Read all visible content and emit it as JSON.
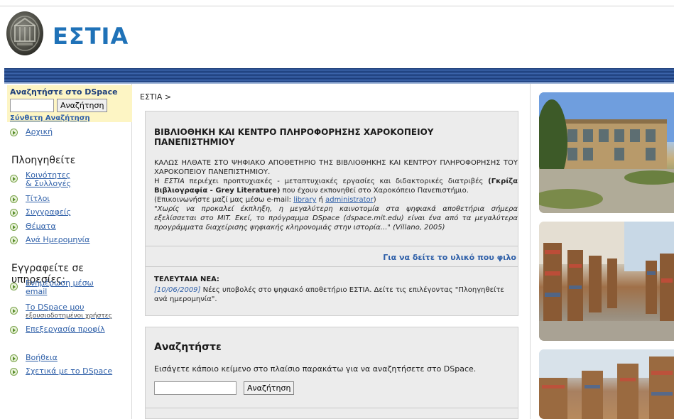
{
  "header": {
    "title": "ΕΣΤΙΑ",
    "logo_icon": "ancient-coin-logo-icon"
  },
  "sidebar": {
    "search": {
      "title": "Αναζητήστε στο DSpace",
      "button": "Αναζήτηση",
      "advanced": "Σύνθετη Αναζήτηση"
    },
    "home": "Αρχική",
    "browse_heading": "Πλοηγηθείτε",
    "browse": [
      {
        "label": "Κοινότητες",
        "label2": "& Συλλογές"
      },
      {
        "label": "Τίτλοι"
      },
      {
        "label": "Συγγραφείς"
      },
      {
        "label": "Θέματα"
      },
      {
        "label": "Ανά Ημερομηνία"
      }
    ],
    "subscribe_heading": "Εγγραφείτε σε υπηρεσίες:",
    "subscribe": [
      {
        "label": "Ενημέρωση μέσω",
        "label2": "email"
      },
      {
        "label": "Το DSpace μου",
        "sub": "εξουσιοδοτημένοι χρήστες"
      },
      {
        "label": "Επεξεργασία προφίλ"
      }
    ],
    "help": [
      {
        "label": "Βοήθεια"
      },
      {
        "label": "Σχετικά με το DSpace"
      }
    ]
  },
  "main": {
    "breadcrumb": "ΕΣΤΙΑ >",
    "library_title": "ΒΙΒΛΙΟΘΗΚΗ ΚΑΙ ΚΕΝΤΡΟ ΠΛΗΡΟΦΟΡΗΣΗΣ ΧΑΡΟΚΟΠΕΙΟΥ ΠΑΝΕΠΙΣΤΗΜΙΟΥ",
    "welcome": "ΚΑΛΩΣ ΗΛΘΑΤΕ ΣΤΟ ΨΗΦΙΑΚΟ ΑΠΟΘΕΤΗΡΙΟ ΤΗΣ ΒΙΒΛΙΟΘΗΚΗΣ ΚΑΙ ΚΕΝΤΡΟΥ ΠΛΗΡΟΦΟΡΗΣΗΣ ΤΟΥ ΧΑΡΟΚΟΠΕΙΟΥ ΠΑΝΕΠΙΣΤΗΜΙΟΥ.",
    "desc_pre": "Η ",
    "desc_estia": "ΕΣΤΙΑ",
    "desc_mid": " περιέχει προπτυχιακές - μεταπτυχιακές εργασίες και διδακτορικές διατριβές ",
    "desc_bold": "(Γκρίζα Βιβλιογραφία - Grey Literature)",
    "desc_post": " που έχουν εκπονηθεί στο Χαροκόπειο Πανεπιστήμιο.",
    "contact_pre": "(Επικοινωνήστε μαζί μας μέσω e-mail: ",
    "contact_library": "library",
    "contact_or": " ή ",
    "contact_admin": "administrator",
    "contact_post": ")",
    "quote": "\"Χωρίς να προκαλεί έκπληξη, η μεγαλύτερη καινοτομία στα ψηφιακά αποθετήρια σήμερα εξελίσσεται στο MIT. Εκεί, το πρόγραμμα DSpace (dspace.mit.edu) είναι ένα από τα μεγαλύτερα προγράμματα διαχείρισης ψηφιακής κληρονομιάς στην ιστορία...\" (Villano, 2005)",
    "more_link": "Για να δείτε το υλικό που φιλο",
    "news_heading": "ΤΕΛΕΥΤΑΙΑ ΝΕΑ:",
    "news_date": "[10/06/2009]",
    "news_text": " Νέες υποβολές στο ψηφιακό αποθετήριο ΕΣΤΙΑ. Δείτε τις επιλέγοντας \"Πλοηγηθείτε ανά ημερομηνία\".",
    "search_title": "Αναζητήστε",
    "search_text": "Εισάγετε κάποιο κείμενο στο πλαίσιο παρακάτω για να αναζητήσετε στο DSpace.",
    "search_button": "Αναζήτηση"
  },
  "colors": {
    "title_blue": "#1f72b8",
    "link_blue": "#2e5fa8",
    "bar_navy": "#1c3d7a",
    "search_bg": "#fdf5c4",
    "panel_bg": "#ececec"
  }
}
